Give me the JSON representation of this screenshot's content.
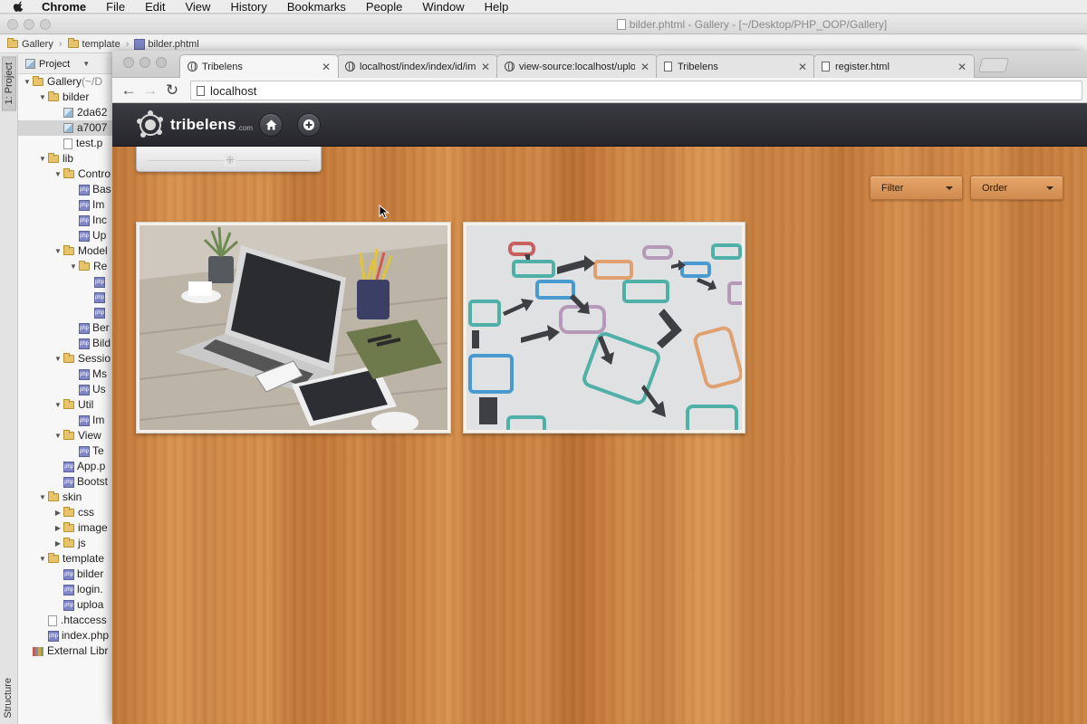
{
  "menubar": {
    "app": "Chrome",
    "items": [
      "File",
      "Edit",
      "View",
      "History",
      "Bookmarks",
      "People",
      "Window",
      "Help"
    ]
  },
  "ide": {
    "window_title": "bilder.phtml - Gallery - [~/Desktop/PHP_OOP/Gallery]",
    "breadcrumb": [
      "Gallery",
      "template",
      "bilder.phtml"
    ],
    "tool_tabs": {
      "project": "1: Project",
      "structure": "Structure"
    },
    "project_header": "Project",
    "tree": [
      {
        "label": "Gallery",
        "suffix": " (~/D",
        "indent": 0,
        "kind": "folder",
        "open": true
      },
      {
        "label": "bilder",
        "indent": 1,
        "kind": "folder",
        "open": true
      },
      {
        "label": "2da62",
        "indent": 2,
        "kind": "img"
      },
      {
        "label": "a7007",
        "indent": 2,
        "kind": "img",
        "selected": true
      },
      {
        "label": "test.p",
        "indent": 2,
        "kind": "file"
      },
      {
        "label": "lib",
        "indent": 1,
        "kind": "folder",
        "open": true
      },
      {
        "label": "Contro",
        "indent": 2,
        "kind": "folder",
        "open": true
      },
      {
        "label": "Bas",
        "indent": 3,
        "kind": "php"
      },
      {
        "label": "Im",
        "indent": 3,
        "kind": "php"
      },
      {
        "label": "Inc",
        "indent": 3,
        "kind": "php"
      },
      {
        "label": "Up",
        "indent": 3,
        "kind": "php"
      },
      {
        "label": "Model",
        "indent": 2,
        "kind": "folder",
        "open": true
      },
      {
        "label": "Re",
        "indent": 3,
        "kind": "folder",
        "open": true
      },
      {
        "label": "",
        "indent": 4,
        "kind": "php"
      },
      {
        "label": "",
        "indent": 4,
        "kind": "php"
      },
      {
        "label": "",
        "indent": 4,
        "kind": "php"
      },
      {
        "label": "Ber",
        "indent": 3,
        "kind": "php"
      },
      {
        "label": "Bild",
        "indent": 3,
        "kind": "php"
      },
      {
        "label": "Sessio",
        "indent": 2,
        "kind": "folder",
        "open": true
      },
      {
        "label": "Ms",
        "indent": 3,
        "kind": "php"
      },
      {
        "label": "Us",
        "indent": 3,
        "kind": "php"
      },
      {
        "label": "Util",
        "indent": 2,
        "kind": "folder",
        "open": true
      },
      {
        "label": "Im",
        "indent": 3,
        "kind": "php"
      },
      {
        "label": "View",
        "indent": 2,
        "kind": "folder",
        "open": true
      },
      {
        "label": "Te",
        "indent": 3,
        "kind": "php"
      },
      {
        "label": "App.p",
        "indent": 2,
        "kind": "php"
      },
      {
        "label": "Bootst",
        "indent": 2,
        "kind": "php"
      },
      {
        "label": "skin",
        "indent": 1,
        "kind": "folder",
        "open": true
      },
      {
        "label": "css",
        "indent": 2,
        "kind": "folder",
        "open": false
      },
      {
        "label": "image",
        "indent": 2,
        "kind": "folder",
        "open": false
      },
      {
        "label": "js",
        "indent": 2,
        "kind": "folder",
        "open": false
      },
      {
        "label": "template",
        "indent": 1,
        "kind": "folder",
        "open": true
      },
      {
        "label": "bilder",
        "indent": 2,
        "kind": "php"
      },
      {
        "label": "login.",
        "indent": 2,
        "kind": "php"
      },
      {
        "label": "uploa",
        "indent": 2,
        "kind": "php"
      },
      {
        "label": ".htaccess",
        "indent": 1,
        "kind": "file"
      },
      {
        "label": "index.php",
        "indent": 1,
        "kind": "php"
      },
      {
        "label": "External Libr",
        "indent": 0,
        "kind": "lib"
      }
    ]
  },
  "browser": {
    "tabs": [
      {
        "title": "Tribelens",
        "icon": "globe-icon",
        "active": true
      },
      {
        "title": "localhost/index/index/id/im",
        "icon": "globe-icon"
      },
      {
        "title": "view-source:localhost/uplo",
        "icon": "globe-icon"
      },
      {
        "title": "Tribelens",
        "icon": "page-icon"
      },
      {
        "title": "register.html",
        "icon": "page-icon"
      }
    ],
    "url": "localhost"
  },
  "site": {
    "brand": "tribelens",
    "brand_suffix": ".com",
    "filter_label": "Filter",
    "order_label": "Order",
    "gallery": [
      {
        "subject": "laptop-desk-photo"
      },
      {
        "subject": "flowchart-photo"
      }
    ]
  }
}
